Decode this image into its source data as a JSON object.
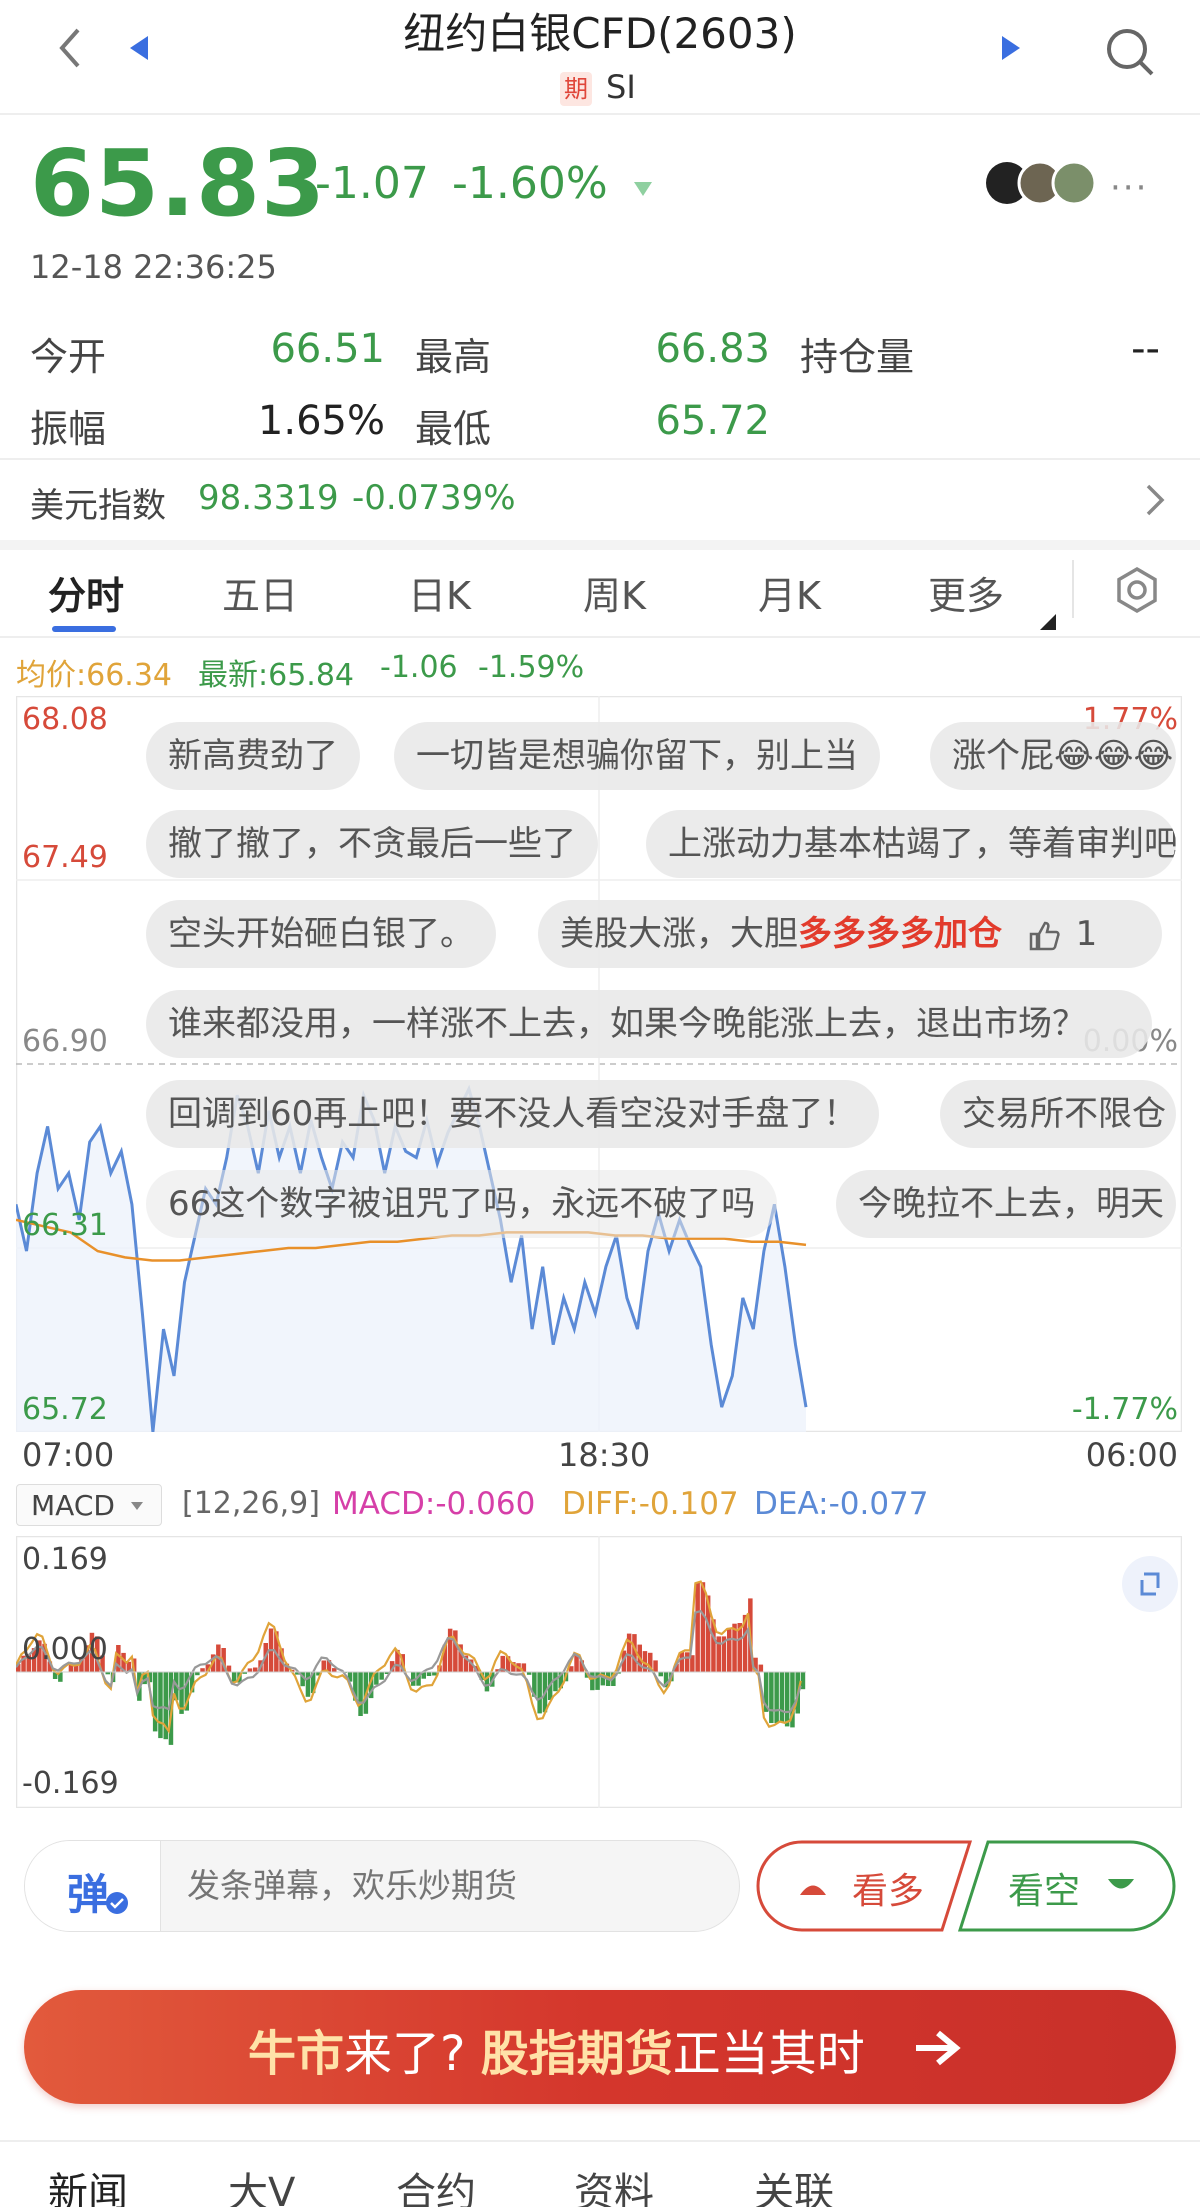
{
  "header": {
    "title": "纽约白银CFD(2603)",
    "badge": "期",
    "code": "SI"
  },
  "quote": {
    "price": "65.83",
    "change": "-1.07",
    "change_pct": "-1.60%",
    "datetime": "12-18 22:36:25"
  },
  "stats": {
    "open_label": "今开",
    "open": "66.51",
    "high_label": "最高",
    "high": "66.83",
    "oi_label": "持仓量",
    "oi": "--",
    "amp_label": "振幅",
    "amp": "1.65%",
    "low_label": "最低",
    "low": "65.72"
  },
  "usd_index": {
    "label": "美元指数",
    "value": "98.3319",
    "change": "-0.0739%"
  },
  "chart_tabs": [
    "分时",
    "五日",
    "日K",
    "周K",
    "月K",
    "更多"
  ],
  "intraday_legend": {
    "avg": "均价:66.34",
    "latest": "最新:65.84",
    "chg": "-1.06",
    "pct": "-1.59%"
  },
  "danmu": [
    "新高费劲了",
    "一切皆是想骗你留下，别上当",
    "涨个屁😂😂😂",
    "撤了撤了，不贪最后一些了",
    "上涨动力基本枯竭了，等着审判吧",
    "空头开始砸白银了。",
    "美股大涨，大胆",
    "多多多多加仓",
    "1",
    "谁来都没用，一样涨不上去，如果今晚能涨上去，退出市场？",
    "回调到60再上吧！要不没人看空没对手盘了！",
    "交易所不限仓",
    "66这个数字被诅咒了吗，永远不破了吗",
    "今晚拉不上去，明天"
  ],
  "macd": {
    "selector": "MACD",
    "params": "[12,26,9]",
    "macd": "MACD:-0.060",
    "diff": "DIFF:-0.107",
    "dea": "DEA:-0.077"
  },
  "input": {
    "icon_text": "弹",
    "placeholder": "发条弹幕，欢乐炒期货",
    "bull": "看多",
    "bear": "看空"
  },
  "banner": {
    "part1": "牛市",
    "part2": "来了?",
    "part3": "股指期货",
    "part4": "正当其时"
  },
  "bottom_tabs": [
    "新闻",
    "大V",
    "合约",
    "资料",
    "关联"
  ],
  "colors": {
    "up": "#d64a3a",
    "down": "#3c9a4a",
    "avg_line": "#e8902a",
    "price_line": "#5b8ad6",
    "macd": "#d63fa8",
    "diff": "#e0a43a",
    "dea": "#5b8ad6"
  },
  "chart_data": {
    "type": "line",
    "title": "",
    "y_labels_left": [
      "68.08",
      "67.49",
      "66.90",
      "66.31",
      "65.72"
    ],
    "y_labels_right": [
      "1.77%",
      "0.00%",
      "-1.77%"
    ],
    "x_labels": [
      "07:00",
      "18:30",
      "06:00"
    ],
    "ylim": [
      65.72,
      68.08
    ],
    "series": [
      {
        "values": [
          66.45,
          66.3,
          66.55,
          66.7,
          66.5,
          66.55,
          66.4,
          66.65,
          66.7,
          66.55,
          66.62,
          66.45,
          66.1,
          65.72,
          66.05,
          65.9,
          66.2,
          66.35,
          66.5,
          66.45,
          66.6,
          66.8,
          66.7,
          66.55,
          66.75,
          66.6,
          66.7,
          66.55,
          66.72,
          66.6,
          66.5,
          66.65,
          66.6,
          66.8,
          66.72,
          66.55,
          66.7,
          66.62,
          66.6,
          66.72,
          66.58,
          66.68,
          66.75,
          66.82,
          66.7,
          66.55,
          66.4,
          66.2,
          66.35,
          66.05,
          66.25,
          66.0,
          66.15,
          66.05,
          66.2,
          66.1,
          66.25,
          66.35,
          66.15,
          66.05,
          66.3,
          66.42,
          66.3,
          66.4,
          66.32,
          66.25,
          66.0,
          65.8,
          65.9,
          66.15,
          66.05,
          66.3,
          66.45,
          66.25,
          66.0,
          65.8
        ]
      },
      {
        "values": [
          66.4,
          66.38,
          66.36,
          66.3,
          66.28,
          66.27,
          66.27,
          66.28,
          66.29,
          66.3,
          66.31,
          66.31,
          66.32,
          66.33,
          66.33,
          66.34,
          66.35,
          66.35,
          66.36,
          66.36,
          66.36,
          66.36,
          66.35,
          66.35,
          66.34,
          66.34,
          66.34,
          66.33,
          66.33,
          66.32
        ]
      }
    ]
  }
}
